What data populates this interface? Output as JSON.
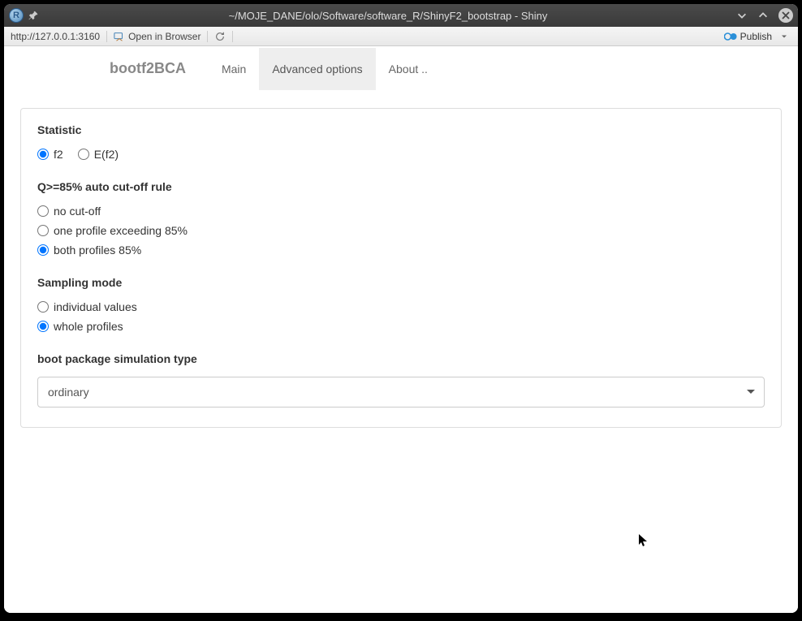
{
  "window": {
    "title": "~/MOJE_DANE/olo/Software/software_R/ShinyF2_bootstrap - Shiny"
  },
  "toolbar": {
    "url": "http://127.0.0.1:3160",
    "open_browser": "Open in Browser",
    "publish": "Publish"
  },
  "navbar": {
    "brand": "bootf2BCA",
    "tabs": [
      {
        "label": "Main"
      },
      {
        "label": "Advanced options"
      },
      {
        "label": "About .."
      }
    ]
  },
  "form": {
    "statistic": {
      "label": "Statistic",
      "options": [
        {
          "label": "f2",
          "checked": true
        },
        {
          "label": "E(f2)",
          "checked": false
        }
      ]
    },
    "cutoff": {
      "label": "Q>=85% auto cut-off rule",
      "options": [
        {
          "label": "no cut-off",
          "checked": false
        },
        {
          "label": "one profile exceeding 85%",
          "checked": false
        },
        {
          "label": "both profiles 85%",
          "checked": true
        }
      ]
    },
    "sampling": {
      "label": "Sampling mode",
      "options": [
        {
          "label": "individual values",
          "checked": false
        },
        {
          "label": "whole profiles",
          "checked": true
        }
      ]
    },
    "simtype": {
      "label": "boot package simulation type",
      "selected": "ordinary"
    }
  }
}
